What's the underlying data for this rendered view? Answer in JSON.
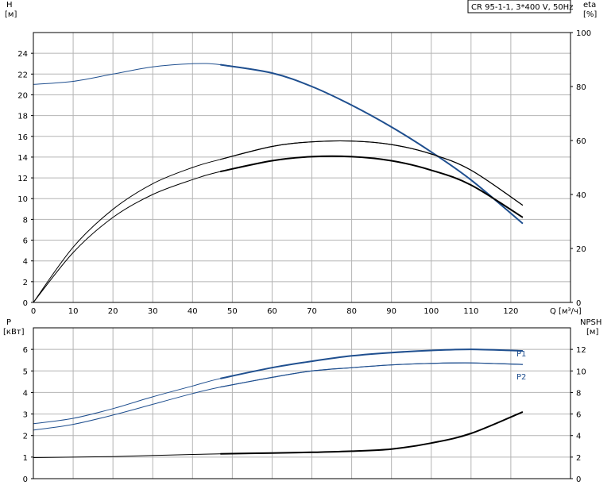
{
  "colors": {
    "blue": "#1f4f8f",
    "black": "#000000",
    "grid": "#b4b4b4",
    "axis": "#000000"
  },
  "chart_data": [
    {
      "type": "line",
      "panel": "top",
      "title": "CR 95-1-1, 3*400 V, 50Hz",
      "xlabel": "Q [м³/ч]",
      "ylabel": "H",
      "yunit": "[м]",
      "y2label": "eta",
      "y2unit": "[%]",
      "xlim": [
        0,
        135
      ],
      "ylim": [
        0,
        26
      ],
      "y2lim": [
        0,
        100
      ],
      "xticks": [
        "0",
        "10",
        "20",
        "30",
        "40",
        "50",
        "60",
        "70",
        "80",
        "90",
        "100",
        "110",
        "120"
      ],
      "yticks": [
        "0",
        "2",
        "4",
        "6",
        "8",
        "10",
        "12",
        "14",
        "16",
        "18",
        "20",
        "22",
        "24"
      ],
      "y2ticks": [
        "0",
        "20",
        "40",
        "60",
        "80",
        "100"
      ],
      "grid": true,
      "series": [
        {
          "id": "H",
          "axis": "left",
          "color": "#1f4f8f",
          "x": [
            0,
            10,
            20,
            30,
            40,
            47,
            60,
            70,
            80,
            90,
            100,
            110,
            123
          ],
          "y": [
            21.0,
            21.3,
            22.0,
            22.7,
            23.0,
            22.9,
            22.1,
            20.8,
            19.0,
            16.9,
            14.5,
            11.8,
            7.6
          ]
        },
        {
          "id": "eta-upper",
          "axis": "right",
          "color": "#000000",
          "x": [
            0,
            10,
            20,
            30,
            40,
            47,
            60,
            70,
            80,
            90,
            100,
            110,
            123
          ],
          "y": [
            0,
            20.5,
            34.5,
            44,
            50,
            53,
            57.8,
            59.5,
            59.8,
            58.5,
            55,
            49,
            36
          ]
        },
        {
          "id": "eta-lower",
          "axis": "right",
          "color": "#000000",
          "x": [
            0,
            10,
            20,
            30,
            40,
            47,
            60,
            70,
            80,
            90,
            100,
            110,
            123
          ],
          "y": [
            0,
            18.5,
            31.5,
            40,
            45.5,
            48.5,
            52.5,
            54,
            54,
            52.5,
            49,
            43.5,
            31.5
          ]
        }
      ]
    },
    {
      "type": "line",
      "panel": "bottom",
      "ylabel": "P",
      "yunit": "[кВт]",
      "y2label": "NPSH",
      "y2unit": "[м]",
      "xlim": [
        0,
        135
      ],
      "ylim": [
        0,
        7
      ],
      "y2lim": [
        0,
        14
      ],
      "yticks": [
        "0",
        "1",
        "2",
        "3",
        "4",
        "5",
        "6"
      ],
      "y2ticks": [
        "0",
        "2",
        "4",
        "6",
        "8",
        "10",
        "12"
      ],
      "grid": true,
      "series": [
        {
          "id": "P1",
          "name": "P1",
          "axis": "left",
          "color": "#1f4f8f",
          "x": [
            0,
            10,
            20,
            30,
            40,
            47,
            60,
            70,
            80,
            90,
            100,
            110,
            123
          ],
          "y": [
            2.55,
            2.8,
            3.25,
            3.8,
            4.3,
            4.65,
            5.15,
            5.45,
            5.7,
            5.85,
            5.95,
            6.0,
            5.93
          ]
        },
        {
          "id": "P2",
          "name": "P2",
          "axis": "left",
          "color": "#1f4f8f",
          "x": [
            0,
            10,
            20,
            30,
            40,
            47,
            60,
            70,
            80,
            90,
            100,
            110,
            123
          ],
          "y": [
            2.25,
            2.52,
            2.95,
            3.45,
            3.95,
            4.25,
            4.7,
            5.0,
            5.15,
            5.28,
            5.35,
            5.37,
            5.3
          ]
        },
        {
          "id": "NPSH",
          "axis": "right",
          "color": "#000000",
          "x": [
            0,
            10,
            20,
            30,
            40,
            47,
            60,
            70,
            80,
            90,
            100,
            110,
            123
          ],
          "y": [
            1.95,
            2.0,
            2.05,
            2.15,
            2.25,
            2.3,
            2.38,
            2.45,
            2.55,
            2.75,
            3.3,
            4.2,
            6.2
          ]
        }
      ]
    }
  ]
}
